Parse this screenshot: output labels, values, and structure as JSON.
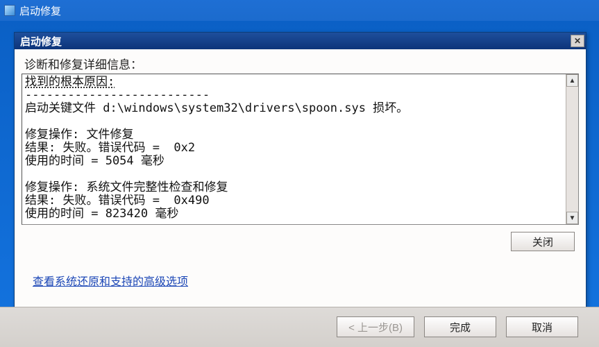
{
  "parent_window": {
    "title": "启动修复"
  },
  "dialog": {
    "title": "启动修复",
    "heading": "诊断和修复详细信息：",
    "log": {
      "line1_label": "找到的根本原因:",
      "line1_dashes": "--------------------------",
      "line_file": "启动关键文件 d:\\windows\\system32\\drivers\\spoon.sys 损坏。",
      "op1_action": "修复操作: 文件修复",
      "op1_result": "结果: 失败。错误代码 =  0x2",
      "op1_time": "使用的时间 = 5054 毫秒",
      "op2_action": "修复操作: 系统文件完整性检查和修复",
      "op2_result": "结果: 失败。错误代码 =  0x490",
      "op2_time": "使用的时间 = 823420 毫秒"
    },
    "close_button": "关闭",
    "link": "查看系统还原和支持的高级选项"
  },
  "wizard": {
    "back": "< 上一步(B)",
    "finish": "完成",
    "cancel": "取消"
  }
}
